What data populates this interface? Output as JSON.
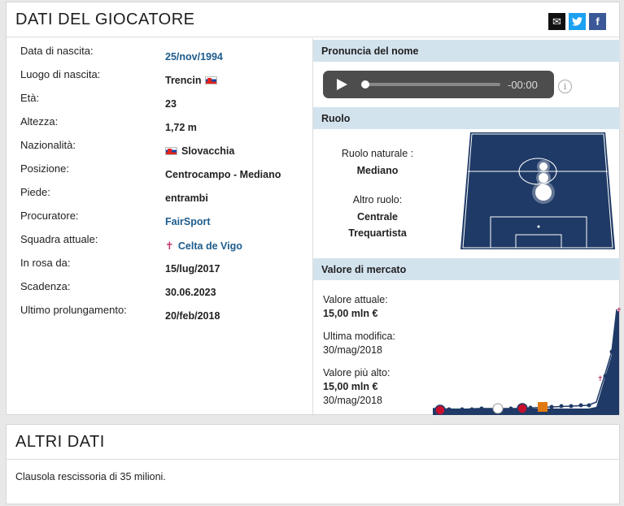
{
  "player_box": {
    "title": "DATI DEL GIOCATORE",
    "rows": [
      {
        "label": "Data di nascita:",
        "value": "25/nov/1994",
        "link": true
      },
      {
        "label": "Luogo di nascita:",
        "value": "Trencin",
        "flag": true
      },
      {
        "label": "Età:",
        "value": "23"
      },
      {
        "label": "Altezza:",
        "value": "1,72 m"
      },
      {
        "label": "Nazionalità:",
        "value": "Slovacchia",
        "flag_before": true
      },
      {
        "label": "Posizione:",
        "value": "Centrocampo - Mediano"
      },
      {
        "label": "Piede:",
        "value": "entrambi"
      },
      {
        "label": "Procuratore:",
        "value": "FairSport",
        "link": true
      },
      {
        "label": "Squadra attuale:",
        "value": "Celta de Vigo",
        "link": true,
        "club_icon": true
      },
      {
        "label": "In rosa da:",
        "value": "15/lug/2017"
      },
      {
        "label": "Scadenza:",
        "value": "30.06.2023"
      },
      {
        "label": "Ultimo prolungamento:",
        "value": "20/feb/2018"
      }
    ]
  },
  "pronunciation": {
    "title": "Pronuncia del nome",
    "time": "-00:00",
    "progress": 0
  },
  "role": {
    "title": "Ruolo",
    "natural_label": "Ruolo naturale :",
    "natural_value": "Mediano",
    "other_label": "Altro ruolo:",
    "other_value_1": "Centrale",
    "other_value_2": "Trequartista"
  },
  "market": {
    "title": "Valore di mercato",
    "current_label": "Valore attuale:",
    "current_value": "15,00 mln €",
    "modified_label": "Ultima modifica:",
    "modified_date": "30/mag/2018",
    "highest_label": "Valore più alto:",
    "highest_value": "15,00 mln €",
    "highest_date": "30/mag/2018"
  },
  "other_box": {
    "title": "ALTRI DATI",
    "text": "Clausola rescissoria di 35 milioni."
  },
  "colors": {
    "link": "#1d5c8c",
    "section_header": "#d3e3ee",
    "pitch": "#1f3a66",
    "twitter": "#1da1f2",
    "facebook": "#3b5998"
  }
}
